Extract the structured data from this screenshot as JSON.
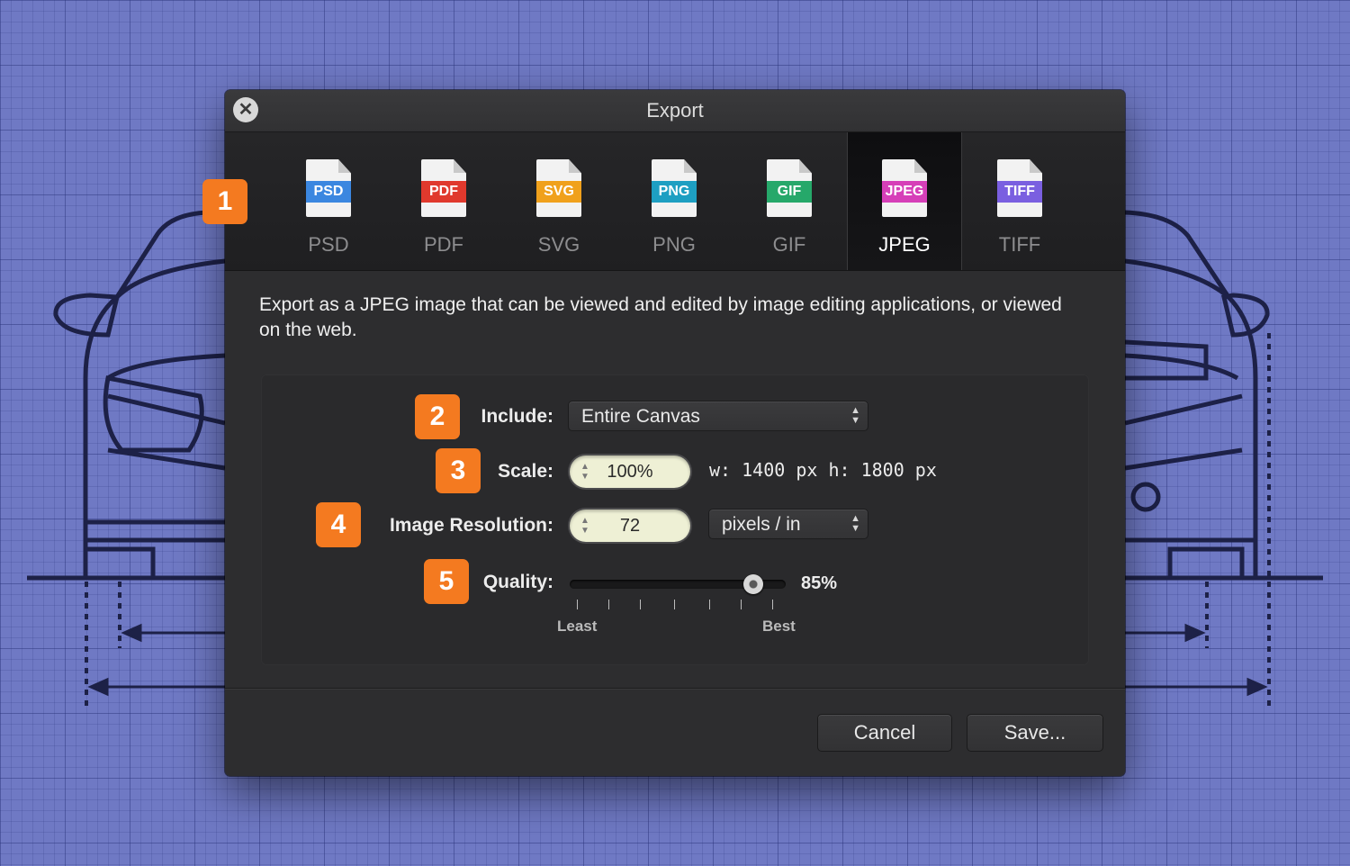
{
  "dialog": {
    "title": "Export"
  },
  "formats": [
    {
      "name": "PSD",
      "label": "PSD",
      "color": "#3b87e0",
      "selected": false
    },
    {
      "name": "PDF",
      "label": "PDF",
      "color": "#e0392d",
      "selected": false
    },
    {
      "name": "SVG",
      "label": "SVG",
      "color": "#f0a11c",
      "selected": false
    },
    {
      "name": "PNG",
      "label": "PNG",
      "color": "#1e9fc2",
      "selected": false
    },
    {
      "name": "GIF",
      "label": "GIF",
      "color": "#26a86a",
      "selected": false
    },
    {
      "name": "JPEG",
      "label": "JPEG",
      "color": "#d63fb8",
      "selected": true
    },
    {
      "name": "TIFF",
      "label": "TIFF",
      "color": "#7a5fe0",
      "selected": false
    }
  ],
  "badges": {
    "b1": "1",
    "b2": "2",
    "b3": "3",
    "b4": "4",
    "b5": "5"
  },
  "description": "Export as a JPEG image that can be viewed and edited by image editing applications, or viewed on the web.",
  "options": {
    "include_label": "Include:",
    "include_value": "Entire Canvas",
    "scale_label": "Scale:",
    "scale_value": "100%",
    "dims_text": "w: 1400 px  h: 1800 px",
    "resolution_label": "Image Resolution:",
    "resolution_value": "72",
    "resolution_unit": "pixels / in",
    "quality_label": "Quality:",
    "quality_value": "85%",
    "quality_fraction": 0.85,
    "quality_min_label": "Least",
    "quality_max_label": "Best"
  },
  "buttons": {
    "cancel": "Cancel",
    "save": "Save..."
  },
  "colors": {
    "accent": "#f47a20",
    "blueprint_bg": "#6f79c4",
    "dialog_bg": "#2d2d2f"
  }
}
